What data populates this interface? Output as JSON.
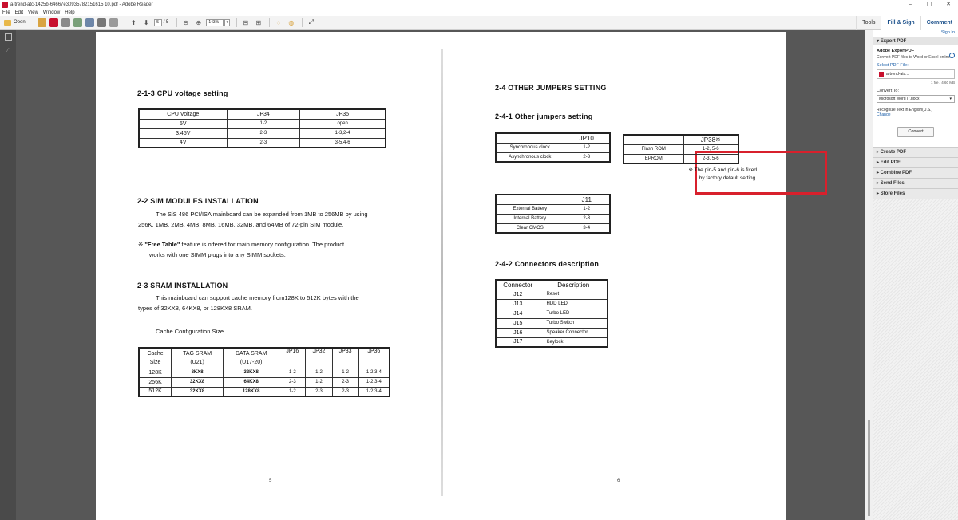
{
  "window": {
    "title": "a-trend-atc-1425b-64667e30935782151615 10.pdf - Adobe Reader",
    "minimize": "–",
    "restore": "▢",
    "close": "✕"
  },
  "menu": [
    "File",
    "Edit",
    "View",
    "Window",
    "Help"
  ],
  "toolbar": {
    "open_label": "Open",
    "page_current": "5",
    "page_total": "/ 5",
    "zoom": "143%"
  },
  "right_tabs": {
    "tools": "Tools",
    "fill_sign": "Fill & Sign",
    "comment": "Comment"
  },
  "pane": {
    "sign_in": "Sign In",
    "export_header": "▾ Export PDF",
    "export_title": "Adobe ExportPDF",
    "export_desc": "Convert PDF files to Word or Excel online.",
    "select_file": "Select PDF File:",
    "file_name": "a-trend-atc...",
    "file_count": "1 file / 4.60 MB",
    "convert_to": "Convert To:",
    "convert_format": "Microsoft Word (*.docx)",
    "recognize": "Recognize Text in English(U.S.)",
    "change": "Change",
    "convert_btn": "Convert",
    "sections": [
      "▸ Create PDF",
      "▸ Edit PDF",
      "▸ Combine PDF",
      "▸ Send Files",
      "▸ Store Files"
    ]
  },
  "left_page": {
    "h_cpu": "2-1-3  CPU voltage setting",
    "cpu_table": {
      "headers": [
        "CPU Voltage",
        "JP34",
        "JP35"
      ],
      "rows": [
        [
          "5V",
          "1-2",
          "open"
        ],
        [
          "3.45V",
          "2-3",
          "1-3,2-4"
        ],
        [
          "4V",
          "2-3",
          "3-5,4-6"
        ]
      ]
    },
    "h_sim": "2-2  SIM MODULES INSTALLATION",
    "sim_p1": "The SiS 486 PCI/ISA mainboard can be expanded from 1MB to 256MB by using",
    "sim_p2": "256K, 1MB, 2MB, 4MB, 8MB, 16MB, 32MB, and 64MB of 72-pin SIM module.",
    "free_p1_mark": "※ ",
    "free_p1_bold": "\"Free Table\"",
    "free_p1_rest": " feature is offered for main memory configuration. The product",
    "free_p2": "works with one SIMM plugs into any SIMM sockets.",
    "h_sram": "2-3  SRAM INSTALLATION",
    "sram_p1": "This mainboard can support cache memory from128K  to 512K bytes with the",
    "sram_p2": "types of 32KX8, 64KX8, or 128KX8 SRAM.",
    "cache_caption": "Cache Configuration Size",
    "cache_table": {
      "headers": [
        [
          "Cache",
          "Size"
        ],
        [
          "TAG SRAM",
          "(U21)"
        ],
        [
          "DATA SRAM",
          "(U17-20)"
        ],
        [
          "JP16",
          ""
        ],
        [
          "JP32",
          ""
        ],
        [
          "JP33",
          ""
        ],
        [
          "JP36",
          ""
        ]
      ],
      "rows": [
        [
          "128K",
          "8KX8",
          "32KX8",
          "1-2",
          "1-2",
          "1-2",
          "1-2,3-4"
        ],
        [
          "256K",
          "32KX8",
          "64KX8",
          "2-3",
          "1-2",
          "2-3",
          "1-2,3-4"
        ],
        [
          "512K",
          "32KX8",
          "128KX8",
          "1-2",
          "2-3",
          "2-3",
          "1-2,3-4"
        ]
      ]
    },
    "page_num": "5"
  },
  "right_page": {
    "h_other": "2-4  OTHER JUMPERS SETTING",
    "h_441": "2-4-1  Other jumpers setting",
    "jp10_table": {
      "headers": [
        "",
        "JP10"
      ],
      "rows": [
        [
          "Synchronous clock",
          "1-2"
        ],
        [
          "Asynchronous clock",
          "2-3"
        ]
      ]
    },
    "jp38_table": {
      "headers": [
        "",
        "JP38※"
      ],
      "rows": [
        [
          "Flash ROM",
          "1-2, 5-6"
        ],
        [
          "EPROM",
          "2-3, 5-6"
        ]
      ]
    },
    "note1": "※ The pin-5 and pin-6 is fixed",
    "note2": "by factory default setting.",
    "j11_table": {
      "headers": [
        "",
        "J11"
      ],
      "rows": [
        [
          "External Battery",
          "1-2"
        ],
        [
          "Internal Battery",
          "2-3"
        ],
        [
          "Clear CMOS",
          "3-4"
        ]
      ]
    },
    "h_442": "2-4-2  Connectors description",
    "conn_table": {
      "headers": [
        "Connector",
        "Description"
      ],
      "rows": [
        [
          "J12",
          "Reset"
        ],
        [
          "J13",
          "HDD LED"
        ],
        [
          "J14",
          "Turbo LED"
        ],
        [
          "J15",
          "Turbo Switch"
        ],
        [
          "J16",
          "Speaker Connector"
        ],
        [
          "J17",
          "Keylock"
        ]
      ]
    },
    "page_num": "6"
  },
  "colors": {
    "highlight": "#d8202c",
    "link": "#1a5ea8",
    "doc_bg": "#575757"
  }
}
